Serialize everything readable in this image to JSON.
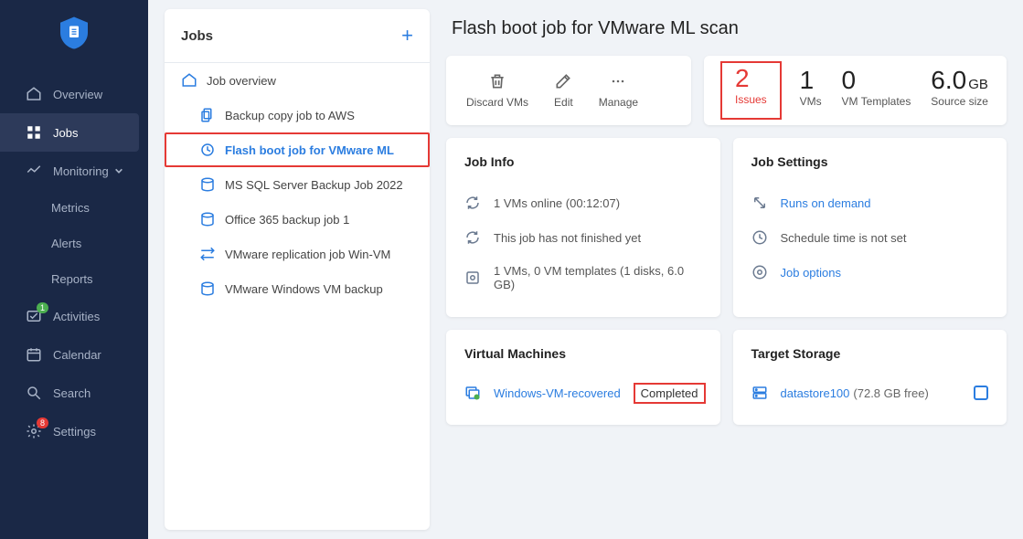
{
  "sidebar": {
    "items": [
      {
        "label": "Overview"
      },
      {
        "label": "Jobs"
      },
      {
        "label": "Monitoring"
      },
      {
        "label": "Metrics"
      },
      {
        "label": "Alerts"
      },
      {
        "label": "Reports"
      },
      {
        "label": "Activities",
        "badge": "1"
      },
      {
        "label": "Calendar"
      },
      {
        "label": "Search"
      },
      {
        "label": "Settings",
        "badge": "8"
      }
    ]
  },
  "jobs_panel": {
    "title": "Jobs",
    "overview_label": "Job overview",
    "list": [
      {
        "label": "Backup copy job to AWS"
      },
      {
        "label": "Flash boot job for VMware ML",
        "selected": true
      },
      {
        "label": "MS SQL Server Backup Job 2022"
      },
      {
        "label": "Office 365 backup job 1"
      },
      {
        "label": "VMware replication job Win-VM"
      },
      {
        "label": "VMware Windows VM backup"
      }
    ]
  },
  "page": {
    "title": "Flash boot job for VMware ML scan"
  },
  "actions": {
    "discard": "Discard VMs",
    "edit": "Edit",
    "manage": "Manage"
  },
  "stats": {
    "issues_num": "2",
    "issues_label": "Issues",
    "vms_num": "1",
    "vms_label": "VMs",
    "templates_num": "0",
    "templates_label": "VM Templates",
    "size_num": "6.0",
    "size_unit": "GB",
    "size_label": "Source size"
  },
  "job_info": {
    "title": "Job Info",
    "r1": "1 VMs online (00:12:07)",
    "r2": "This job has not finished yet",
    "r3": "1 VMs, 0 VM templates (1 disks, 6.0 GB)"
  },
  "job_settings": {
    "title": "Job Settings",
    "r1": "Runs on demand",
    "r2": "Schedule time is not set",
    "r3": "Job options"
  },
  "vms": {
    "title": "Virtual Machines",
    "name": "Windows-VM-recovered",
    "status": "Completed"
  },
  "storage": {
    "title": "Target Storage",
    "name": "datastore100",
    "free": "(72.8 GB free)"
  }
}
